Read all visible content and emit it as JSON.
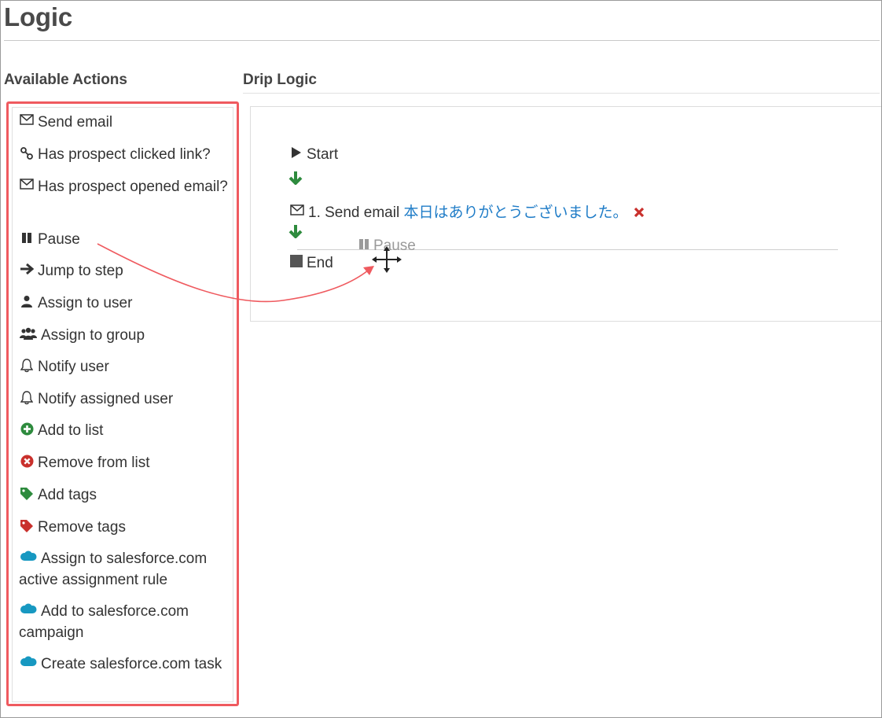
{
  "page": {
    "title": "Logic"
  },
  "available_actions": {
    "heading": "Available Actions",
    "items": [
      {
        "label": "Send email",
        "icon": "envelope-icon"
      },
      {
        "label": "Has prospect clicked link?",
        "icon": "link-icon"
      },
      {
        "label": "Has prospect opened email?",
        "icon": "envelope-icon"
      },
      {
        "label": "Pause",
        "icon": "pause-icon"
      },
      {
        "label": "Jump to step",
        "icon": "arrow-right-icon"
      },
      {
        "label": "Assign to user",
        "icon": "user-icon"
      },
      {
        "label": "Assign to group",
        "icon": "users-icon"
      },
      {
        "label": "Notify user",
        "icon": "bell-icon"
      },
      {
        "label": "Notify assigned user",
        "icon": "bell-icon"
      },
      {
        "label": "Add to list",
        "icon": "plus-circle-icon"
      },
      {
        "label": "Remove from list",
        "icon": "x-circle-icon"
      },
      {
        "label": "Add tags",
        "icon": "tag-icon"
      },
      {
        "label": "Remove tags",
        "icon": "tag-icon"
      },
      {
        "label": "Assign to salesforce.com active assignment rule",
        "icon": "cloud-icon"
      },
      {
        "label": "Add to salesforce.com campaign",
        "icon": "cloud-icon"
      },
      {
        "label": "Create salesforce.com task",
        "icon": "cloud-icon"
      }
    ]
  },
  "drip_logic": {
    "heading": "Drip Logic",
    "start_label": "Start",
    "step1": {
      "prefix": "1. Send email",
      "link": "本日はありがとうございました。"
    },
    "end_label": "End",
    "drag_ghost_label": "Pause"
  },
  "colors": {
    "highlight_border": "#ef5a5f",
    "link": "#1f7cc7",
    "success_green": "#2e8b3e",
    "danger_red": "#c9302c",
    "annotation_arrow": "#ef5a5f"
  }
}
